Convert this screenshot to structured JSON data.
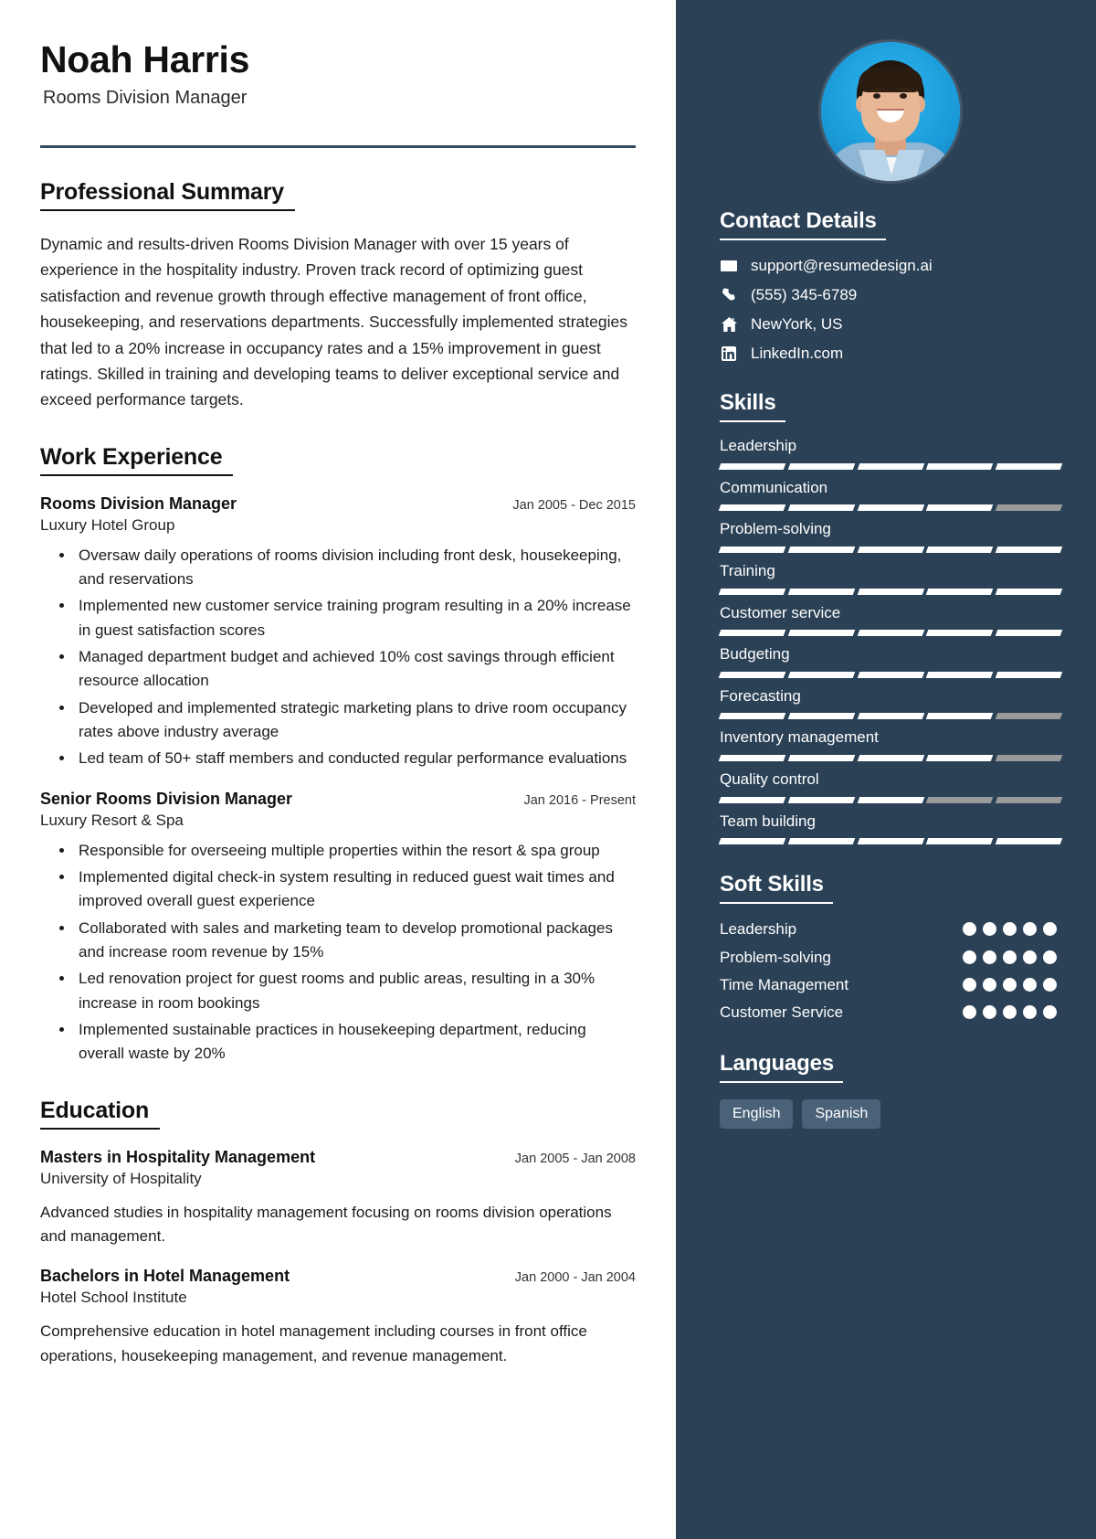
{
  "header": {
    "name": "Noah Harris",
    "role": "Rooms Division Manager"
  },
  "summary": {
    "title": "Professional Summary",
    "text": "Dynamic and results-driven Rooms Division Manager with over 15 years of experience in the hospitality industry. Proven track record of optimizing guest satisfaction and revenue growth through effective management of front office, housekeeping, and reservations departments. Successfully implemented strategies that led to a 20% increase in occupancy rates and a 15% improvement in guest ratings. Skilled in training and developing teams to deliver exceptional service and exceed performance targets."
  },
  "work": {
    "title": "Work Experience",
    "entries": [
      {
        "title": "Rooms Division Manager",
        "org": "Luxury Hotel Group",
        "date": "Jan 2005 - Dec 2015",
        "bullets": [
          "Oversaw daily operations of rooms division including front desk, housekeeping, and reservations",
          "Implemented new customer service training program resulting in a 20% increase in guest satisfaction scores",
          "Managed department budget and achieved 10% cost savings through efficient resource allocation",
          "Developed and implemented strategic marketing plans to drive room occupancy rates above industry average",
          "Led team of 50+ staff members and conducted regular performance evaluations"
        ]
      },
      {
        "title": "Senior Rooms Division Manager",
        "org": "Luxury Resort & Spa",
        "date": "Jan 2016 - Present",
        "bullets": [
          "Responsible for overseeing multiple properties within the resort & spa group",
          "Implemented digital check-in system resulting in reduced guest wait times and improved overall guest experience",
          "Collaborated with sales and marketing team to develop promotional packages and increase room revenue by 15%",
          "Led renovation project for guest rooms and public areas, resulting in a 30% increase in room bookings",
          "Implemented sustainable practices in housekeeping department, reducing overall waste by 20%"
        ]
      }
    ]
  },
  "education": {
    "title": "Education",
    "entries": [
      {
        "title": "Masters in Hospitality Management",
        "org": "University of Hospitality",
        "date": "Jan 2005 - Jan 2008",
        "desc": "Advanced studies in hospitality management focusing on rooms division operations and management."
      },
      {
        "title": "Bachelors in Hotel Management",
        "org": "Hotel School Institute",
        "date": "Jan 2000 - Jan 2004",
        "desc": "Comprehensive education in hotel management including courses in front office operations, housekeeping management, and revenue management."
      }
    ]
  },
  "contact": {
    "title": "Contact Details",
    "items": [
      {
        "icon": "envelope-icon",
        "value": "support@resumedesign.ai"
      },
      {
        "icon": "phone-icon",
        "value": "(555) 345-6789"
      },
      {
        "icon": "home-icon",
        "value": "NewYork, US"
      },
      {
        "icon": "linkedin-icon",
        "value": "LinkedIn.com"
      }
    ]
  },
  "skills": {
    "title": "Skills",
    "max": 5,
    "items": [
      {
        "name": "Leadership",
        "level": 5
      },
      {
        "name": "Communication",
        "level": 4
      },
      {
        "name": "Problem-solving",
        "level": 5
      },
      {
        "name": "Training",
        "level": 5
      },
      {
        "name": "Customer service",
        "level": 5
      },
      {
        "name": "Budgeting",
        "level": 5
      },
      {
        "name": "Forecasting",
        "level": 4
      },
      {
        "name": "Inventory management",
        "level": 4
      },
      {
        "name": "Quality control",
        "level": 3
      },
      {
        "name": "Team building",
        "level": 5
      }
    ]
  },
  "soft_skills": {
    "title": "Soft Skills",
    "max": 5,
    "items": [
      {
        "name": "Leadership",
        "level": 5
      },
      {
        "name": "Problem-solving",
        "level": 5
      },
      {
        "name": "Time Management",
        "level": 5
      },
      {
        "name": "Customer Service",
        "level": 5
      }
    ]
  },
  "languages": {
    "title": "Languages",
    "items": [
      "English",
      "Spanish"
    ]
  },
  "colors": {
    "sidebar": "#2b4156",
    "rule": "#33495e",
    "chip": "#4a6278",
    "bar_on": "#ffffff",
    "bar_off": "#9a9a9a"
  }
}
